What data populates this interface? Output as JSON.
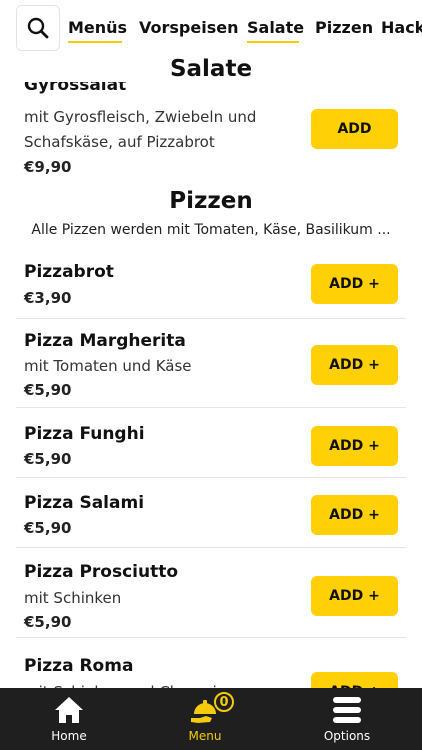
{
  "tabs": [
    {
      "label": "Menüs",
      "active": true
    },
    {
      "label": "Vorspeisen"
    },
    {
      "label": "Salate",
      "active": true
    },
    {
      "label": "Pizzen"
    },
    {
      "label": "Hack"
    }
  ],
  "salate": {
    "title": "Salate",
    "partial_item": {
      "name": "Gyrossalat",
      "desc_line1": "mit Gyrosfleisch, Zwiebeln und",
      "desc_line2": "Schafskäse, auf Pizzabrot",
      "price": "€9,90",
      "button": "ADD"
    }
  },
  "pizzen": {
    "title": "Pizzen",
    "description": "Alle Pizzen werden mit Tomaten, Käse, Basilikum ...",
    "items": [
      {
        "name": "Pizzabrot",
        "desc": "",
        "price": "€3,90",
        "button": "ADD +"
      },
      {
        "name": "Pizza Margherita",
        "desc": "mit Tomaten und Käse",
        "price": "€5,90",
        "button": "ADD +"
      },
      {
        "name": "Pizza Funghi",
        "desc": "",
        "price": "€5,90",
        "button": "ADD +"
      },
      {
        "name": "Pizza Salami",
        "desc": "",
        "price": "€5,90",
        "button": "ADD +"
      },
      {
        "name": "Pizza Prosciutto",
        "desc": "mit Schinken",
        "price": "€5,90",
        "button": "ADD +"
      },
      {
        "name": "Pizza Roma",
        "desc": "mit Schinken und Champignons",
        "price": "",
        "button": "ADD +"
      }
    ]
  },
  "bottom_nav": {
    "home": "Home",
    "menu": "Menu",
    "options": "Options",
    "cart_count": "0"
  },
  "colors": {
    "accent": "#ffd006",
    "nav_bg": "#1f1f1f",
    "active_nav": "#f5cb0c"
  }
}
